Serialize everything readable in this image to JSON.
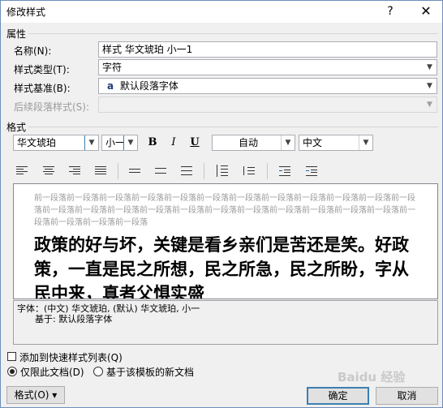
{
  "window": {
    "title": "修改样式",
    "help_label": "?",
    "close_label": "✕"
  },
  "properties": {
    "section_label": "属性",
    "name_label": "名称(N):",
    "name_value": "样式 华文琥珀 小一1",
    "type_label": "样式类型(T):",
    "type_value": "字符",
    "based_on_label": "样式基准(B):",
    "based_on_icon": "a",
    "based_on_value": "默认段落字体",
    "next_label": "后续段落样式(S):",
    "next_value": ""
  },
  "format": {
    "section_label": "格式",
    "font_value": "华文琥珀",
    "size_value": "小一",
    "bold_label": "B",
    "italic_label": "I",
    "underline_label": "U",
    "color_value": "自动",
    "lang_value": "中文"
  },
  "preview": {
    "previous_paragraph": "前一段落前一段落前一段落前一段落前一段落前一段落前一段落前一段落前一段落前一段落前一段落前一段落前一段落前一段落前一段落前一段落前一段落前一段落前一段落前一段落前一段落前一段落前一段落前一段落前一段落前一段落前一段落",
    "sample_text": "政策的好与坏，关键是看乡亲们是苦还是笑。好政策，一直是民之所想，民之所急，民之所盼，字从民中来，真者父惧实盛"
  },
  "description": {
    "line1": "字体：(中文) 华文琥珀, (默认) 华文琥珀, 小一",
    "line2": "基于: 默认段落字体"
  },
  "options": {
    "add_to_gallery_label": "添加到快速样式列表(Q)",
    "only_this_doc_label": "仅限此文档(D)",
    "new_docs_label": "基于该模板的新文档"
  },
  "buttons": {
    "format_label": "格式(O) ▾",
    "ok_label": "确定",
    "cancel_label": "取消"
  },
  "watermark": "Baidu 经验"
}
